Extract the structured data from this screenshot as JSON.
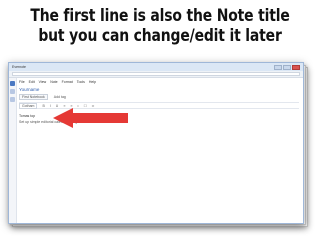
{
  "caption": {
    "line1": "The first line is also the Note title",
    "line2": "but you can change/edit it later"
  },
  "window": {
    "title": "Evernote"
  },
  "menu": {
    "items": [
      "File",
      "Edit",
      "View",
      "Note",
      "Format",
      "Tools",
      "Help"
    ]
  },
  "note": {
    "title": "Yourname",
    "notebook": "First Notebook",
    "tags_label": "Add tag",
    "font": "Gotham",
    "first_line": "Tomas top",
    "body": "Set up simple editorial calendar using Evernote",
    "arrow_color": "#e53935"
  }
}
